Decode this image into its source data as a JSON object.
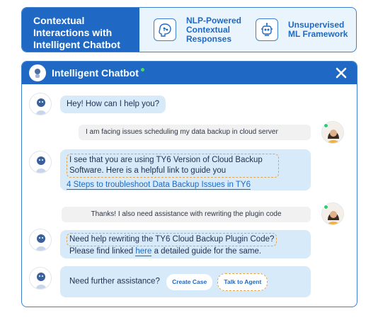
{
  "banner": {
    "title_lines": [
      "Contextual",
      "Interactions with",
      "Intelligent Chatbot"
    ],
    "features": [
      {
        "icon": "brain-circuit-icon",
        "lines": [
          "NLP-Powered",
          "Contextual",
          "Responses"
        ]
      },
      {
        "icon": "robot-head-icon",
        "lines": [
          "Unsupervised",
          "ML Framework"
        ]
      }
    ]
  },
  "chat": {
    "title": "Intelligent Chatbot",
    "messages": [
      {
        "text": "Hey! How can I help you?"
      },
      {
        "text": "I am facing issues scheduling my data backup in cloud server"
      },
      {
        "line1": "I see that you are using TY6 Version of Cloud Backup",
        "line2": "Software. Here is a helpful link to guide you",
        "link": "4 Steps to troubleshoot Data Backup Issues in TY6"
      },
      {
        "text": "Thanks! I also need assistance with rewriting the plugin code"
      },
      {
        "line1": "Need help rewriting the TY6 Cloud Backup Plugin Code?",
        "line2_before": "Please find linked ",
        "line2_link": "here",
        "line2_after": " a detailed guide for the same."
      },
      {
        "text": "Need further assistance?",
        "btn1": "Create Case",
        "btn2": "Talk to Agent"
      }
    ]
  },
  "colors": {
    "primary": "#1f69c4",
    "bot_bubble": "#d7eaf9",
    "user_bubble": "#f1f1f1",
    "highlight": "#e3a348"
  }
}
